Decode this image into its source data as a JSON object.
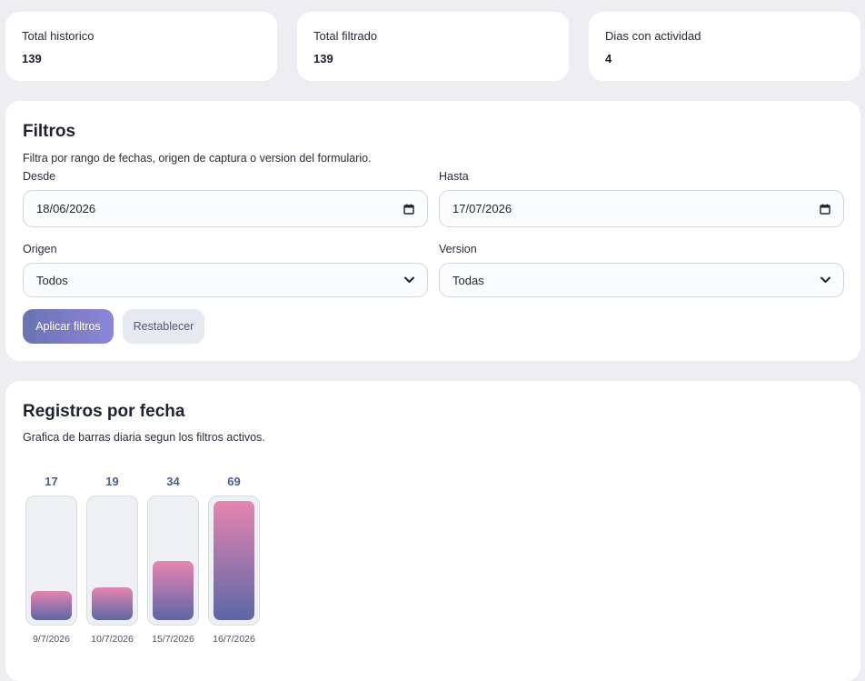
{
  "stats": [
    {
      "label": "Total historico",
      "value": "139"
    },
    {
      "label": "Total filtrado",
      "value": "139"
    },
    {
      "label": "Dias con actividad",
      "value": "4"
    }
  ],
  "filters": {
    "title": "Filtros",
    "description": "Filtra por rango de fechas, origen de captura o version del formulario.",
    "from_label": "Desde",
    "from_value": "18/06/2026",
    "to_label": "Hasta",
    "to_value": "17/07/2026",
    "origin_label": "Origen",
    "origin_value": "Todos",
    "version_label": "Version",
    "version_value": "Todas",
    "apply_label": "Aplicar filtros",
    "reset_label": "Restablecer"
  },
  "chart_section": {
    "title": "Registros por fecha",
    "description": "Grafica de barras diaria segun los filtros activos."
  },
  "chart_data": {
    "type": "bar",
    "categories": [
      "9/7/2026",
      "10/7/2026",
      "15/7/2026",
      "16/7/2026"
    ],
    "values": [
      17,
      19,
      34,
      69
    ],
    "ylim": [
      0,
      69
    ],
    "title": "Registros por fecha",
    "colors": {
      "bar_top": "#e685b0",
      "bar_bottom": "#5b67a6",
      "value_label": "#4b5d92"
    }
  },
  "icons": {
    "calendar": "calendar-icon",
    "chevron": "chevron-down-icon"
  },
  "colors": {
    "page_bg": "#eeedf2",
    "card_bg": "#ffffff",
    "accent_start": "#6a73b3",
    "accent_end": "#8d86d9"
  }
}
